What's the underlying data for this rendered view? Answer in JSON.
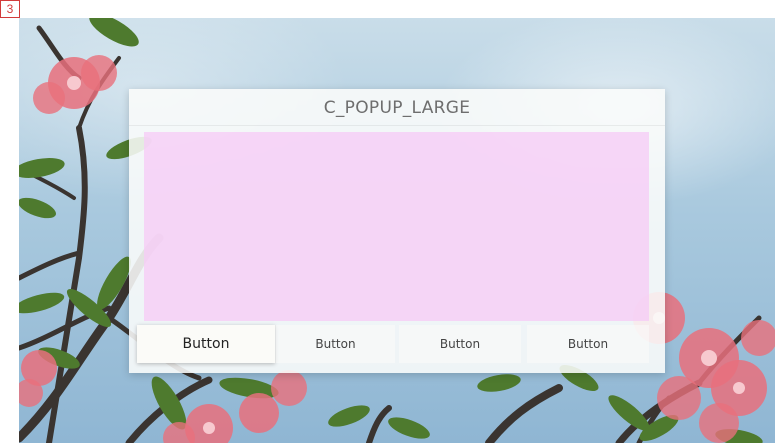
{
  "page_number": "3",
  "popup": {
    "title": "C_POPUP_LARGE",
    "buttons": [
      {
        "label": "Button",
        "focused": true
      },
      {
        "label": "Button",
        "focused": false
      },
      {
        "label": "Button",
        "focused": false
      },
      {
        "label": "Button",
        "focused": false
      }
    ]
  },
  "colors": {
    "sky": "#a9c9de",
    "popup_bg": "#f9fbf9",
    "content_area": "#f6ccf6",
    "title_text": "#6e6e6e",
    "blossom": "#e8707c",
    "leaf": "#4e7a2e",
    "branch": "#3a3430"
  }
}
